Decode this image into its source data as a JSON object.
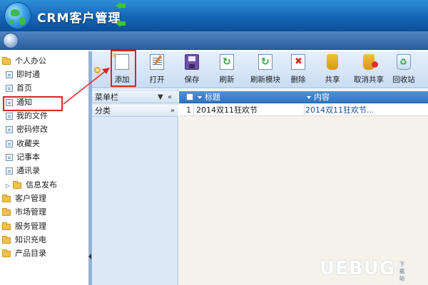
{
  "app": {
    "title": "CRM客户管理"
  },
  "sidebar": {
    "items": [
      {
        "label": "个人办公",
        "type": "folder",
        "expanded": true
      },
      {
        "label": "即时通",
        "type": "page"
      },
      {
        "label": "首页",
        "type": "page"
      },
      {
        "label": "通知",
        "type": "page",
        "highlighted": true
      },
      {
        "label": "我的文件",
        "type": "page"
      },
      {
        "label": "密码修改",
        "type": "page"
      },
      {
        "label": "收藏夹",
        "type": "page"
      },
      {
        "label": "记事本",
        "type": "page"
      },
      {
        "label": "通讯录",
        "type": "page"
      },
      {
        "label": "信息发布",
        "type": "folder"
      },
      {
        "label": "客户管理",
        "type": "folder"
      },
      {
        "label": "市场管理",
        "type": "folder"
      },
      {
        "label": "服务管理",
        "type": "folder"
      },
      {
        "label": "知识充电",
        "type": "folder"
      },
      {
        "label": "产品目录",
        "type": "folder"
      }
    ]
  },
  "toolbar": {
    "buttons": [
      {
        "label": "添加",
        "icon": "new-document-icon",
        "highlighted": true
      },
      {
        "label": "打开",
        "icon": "open-icon"
      },
      {
        "label": "保存",
        "icon": "save-icon"
      },
      {
        "label": "刷新",
        "icon": "refresh-icon"
      },
      {
        "label": "刷新模块",
        "icon": "refresh-module-icon"
      },
      {
        "label": "删除",
        "icon": "delete-icon"
      },
      {
        "label": "共享",
        "icon": "share-icon"
      },
      {
        "label": "取消共享",
        "icon": "unshare-icon"
      },
      {
        "label": "回收站",
        "icon": "recycle-bin-icon"
      }
    ]
  },
  "menu_panel": {
    "header": "菜单栏",
    "dropdown_glyph": "▼",
    "collapse_glyph": "«",
    "category": "分类",
    "category_glyph": "»"
  },
  "grid": {
    "columns": [
      "标题",
      "内容"
    ],
    "rows": [
      {
        "num": "1",
        "title": "2014双11狂欢节",
        "content": "2014双11狂欢节..."
      }
    ]
  },
  "watermark": {
    "text": "UEBUG",
    "sub": "下载站"
  },
  "colors": {
    "header": "#1665b5",
    "annotation": "#e0202a",
    "grid_header": "#2f74c0"
  }
}
